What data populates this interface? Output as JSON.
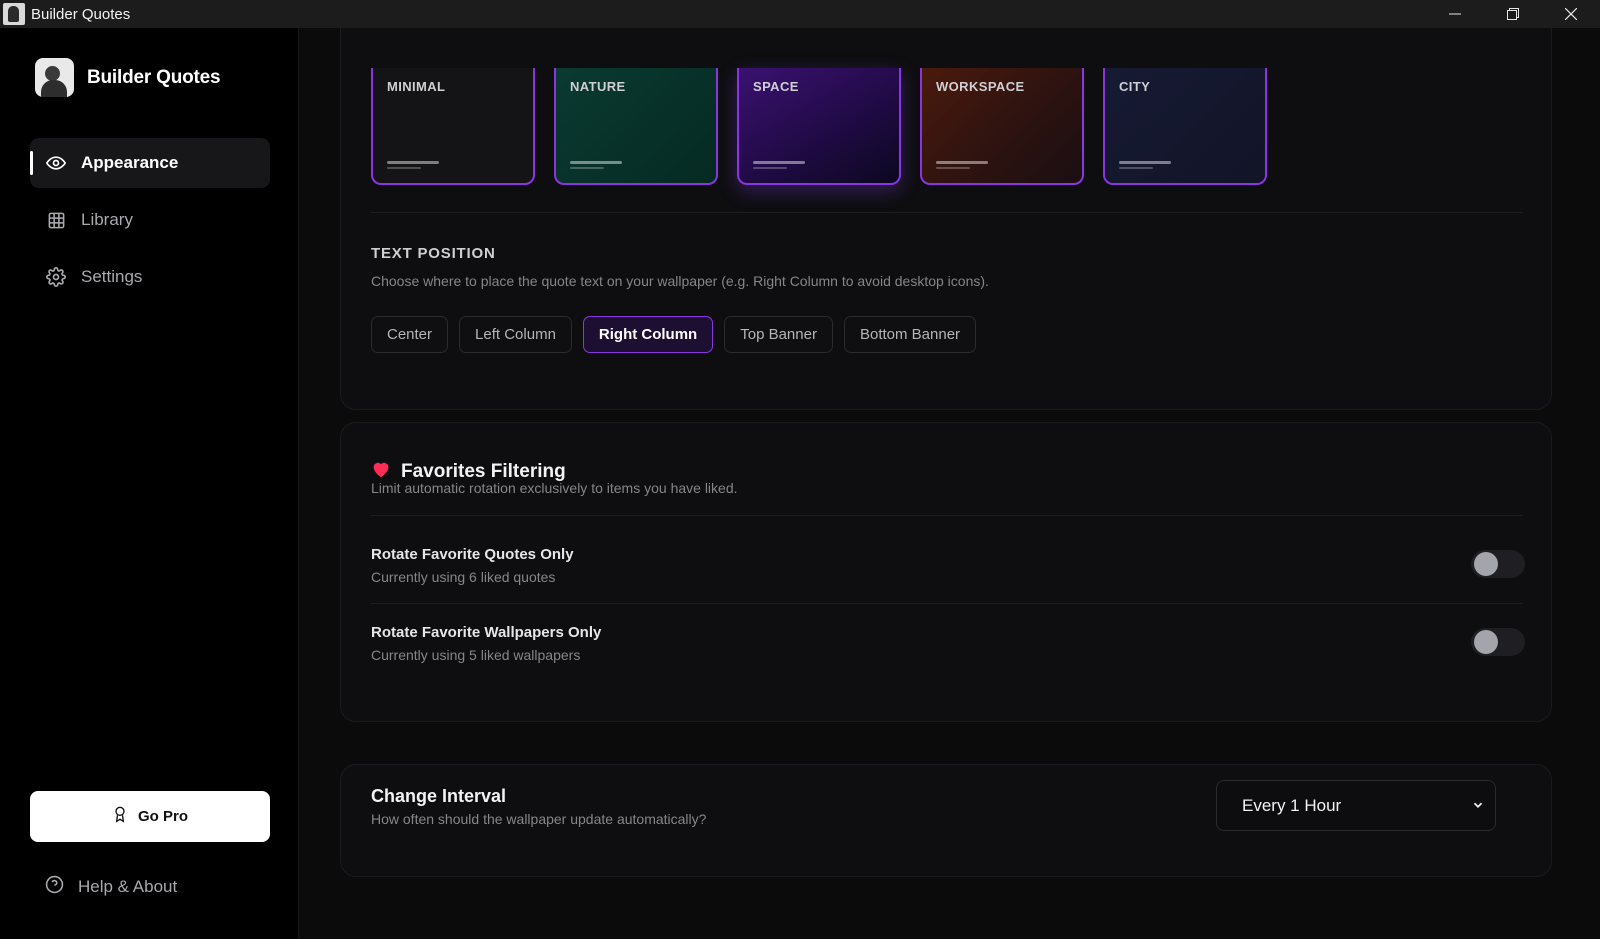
{
  "window": {
    "title": "Builder Quotes"
  },
  "sidebar": {
    "brand": "Builder Quotes",
    "items": [
      {
        "label": "Appearance",
        "icon": "eye-icon",
        "active": true
      },
      {
        "label": "Library",
        "icon": "grid-icon",
        "active": false
      },
      {
        "label": "Settings",
        "icon": "gear-icon",
        "active": false
      }
    ],
    "go_pro_label": "Go Pro",
    "help_label": "Help & About"
  },
  "appearance": {
    "themes": [
      "MINIMAL",
      "NATURE",
      "SPACE",
      "WORKSPACE",
      "CITY"
    ],
    "selected_theme": "SPACE",
    "text_position": {
      "title": "TEXT POSITION",
      "description": "Choose where to place the quote text on your wallpaper (e.g. Right Column to avoid desktop icons).",
      "options": [
        "Center",
        "Left Column",
        "Right Column",
        "Top Banner",
        "Bottom Banner"
      ],
      "selected": "Right Column"
    }
  },
  "favorites": {
    "title": "Favorites Filtering",
    "description": "Limit automatic rotation exclusively to items you have liked.",
    "quotes": {
      "title": "Rotate Favorite Quotes Only",
      "desc": "Currently using 6 liked quotes",
      "enabled": false
    },
    "wallpapers": {
      "title": "Rotate Favorite Wallpapers Only",
      "desc": "Currently using 5 liked wallpapers",
      "enabled": false
    }
  },
  "interval": {
    "title": "Change Interval",
    "description": "How often should the wallpaper update automatically?",
    "selected": "Every 1 Hour"
  },
  "colors": {
    "accent": "#8b35e0",
    "heart": "#ff2d55"
  }
}
